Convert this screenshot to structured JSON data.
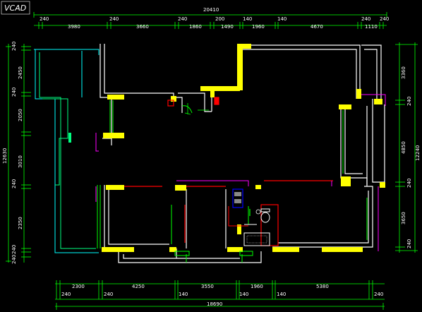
{
  "logo": "VCAD",
  "colors": {
    "background": "#000000",
    "wall": "#ffffff",
    "column": "#ffff00",
    "dimension": "#00ff00",
    "text": "#ffffff",
    "window_outer": "#00ffff",
    "window_inner": "#00ff80",
    "door": "#ff0000",
    "partition": "#ff00ff",
    "fixture": "#0000ff"
  },
  "dimensions": {
    "top_total": "20410",
    "top_segments": [
      "240",
      "3980",
      "240",
      "3660",
      "240",
      "1860",
      "200",
      "1490",
      "140",
      "1960",
      "140",
      "4670",
      "240",
      "1110",
      "240"
    ],
    "bottom_segments": [
      "240",
      "2300",
      "240",
      "4250",
      "140",
      "3550",
      "140",
      "1960",
      "140",
      "5380",
      "240"
    ],
    "bottom_total": "18690",
    "left_segments": [
      "240",
      "2450",
      "240",
      "2050",
      "240",
      "3010",
      "240",
      "2350",
      "240",
      "240"
    ],
    "left_total": "12630",
    "right_segments": [
      "3360",
      "240",
      "4850",
      "240",
      "3650",
      "240"
    ],
    "right_total": "12240"
  }
}
